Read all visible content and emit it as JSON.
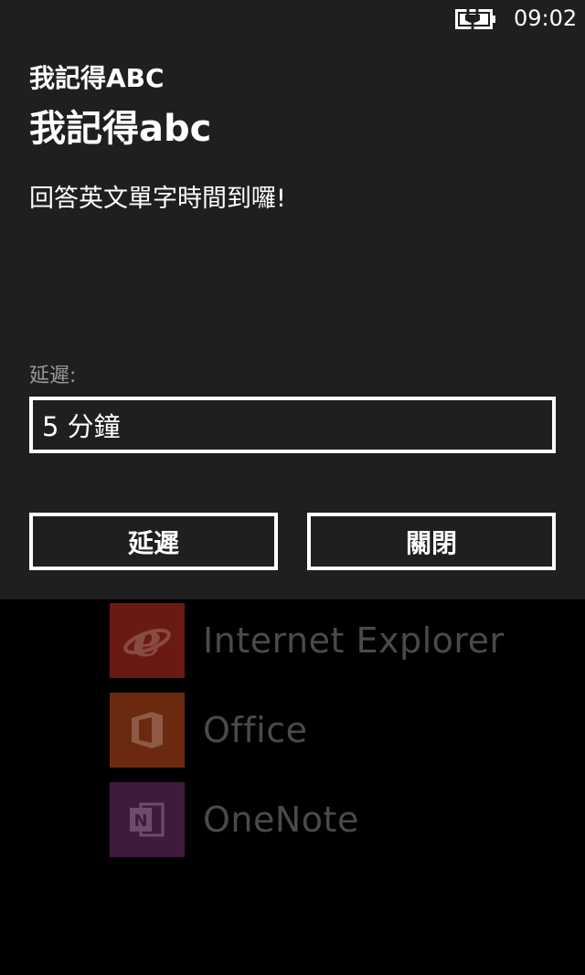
{
  "status_bar": {
    "time": "09:02",
    "battery_icon": "battery-charging-icon"
  },
  "notification": {
    "app_name": "我記得ABC",
    "title": "我記得abc",
    "message": "回答英文單字時間到囉!",
    "snooze_label": "延遲:",
    "snooze_value": "5 分鐘",
    "snooze_button": "延遲",
    "dismiss_button": "關閉",
    "background_color": "#1f1f1f"
  },
  "app_list": {
    "items": [
      {
        "name": "Internet Explorer",
        "icon": "internet-explorer-icon",
        "tile_color": "#6b1a12"
      },
      {
        "name": "Office",
        "icon": "office-icon",
        "tile_color": "#6b2a10"
      },
      {
        "name": "OneNote",
        "icon": "onenote-icon",
        "tile_color": "#3e1a3c"
      }
    ]
  }
}
